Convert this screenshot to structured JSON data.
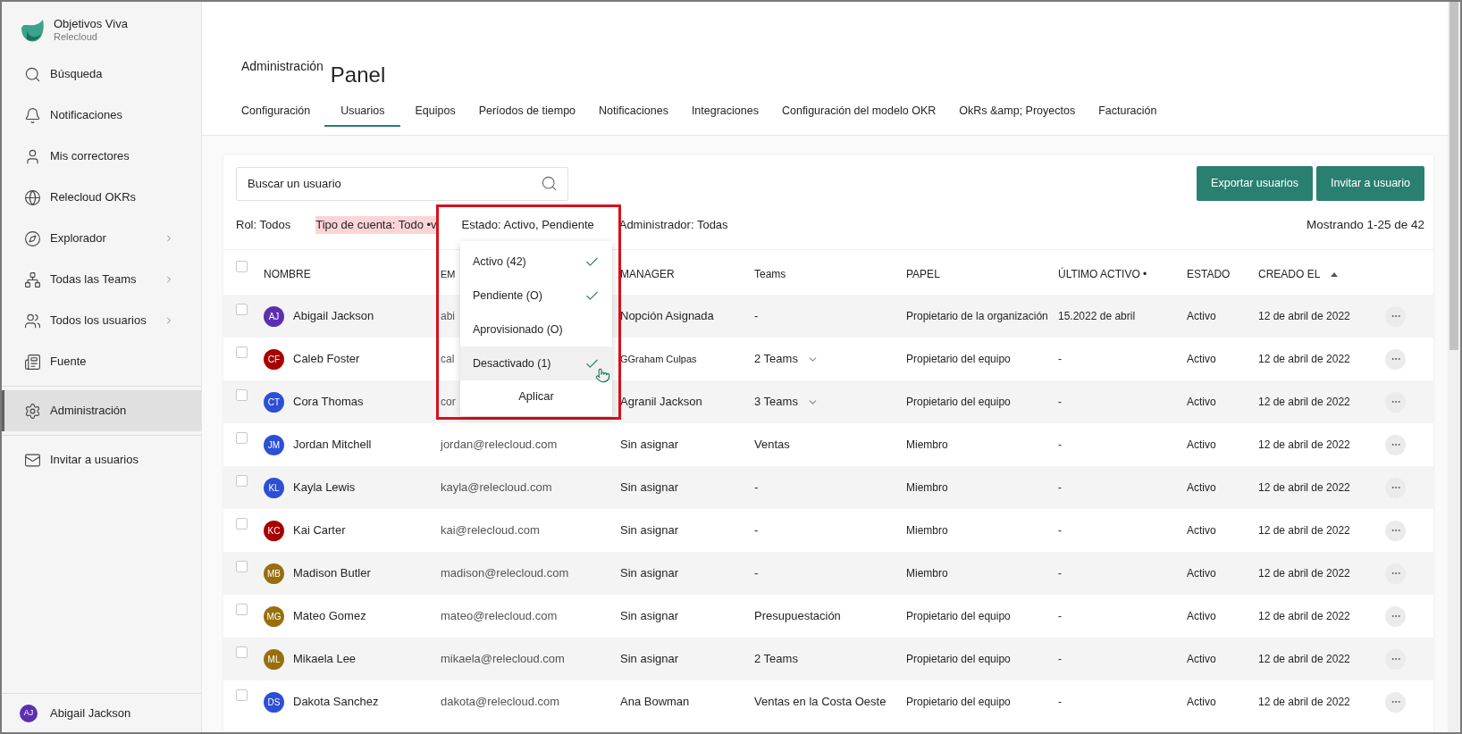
{
  "app": {
    "title": "Objetivos Viva",
    "subtitle": "Relecloud"
  },
  "sidebar": {
    "items": [
      {
        "kind": "search",
        "label": "Búsqueda",
        "selected": false,
        "has_submenu": false
      },
      {
        "kind": "bell",
        "label": "Notificaciones",
        "selected": false,
        "has_submenu": false
      },
      {
        "kind": "person",
        "label": "Mis correctores",
        "selected": false,
        "has_submenu": false
      },
      {
        "kind": "globe",
        "label": "Relecloud OKRs",
        "selected": false,
        "has_submenu": false
      },
      {
        "kind": "compass",
        "label": "Explorador",
        "selected": false,
        "has_submenu": true
      },
      {
        "kind": "teams",
        "label": "Todas las Teams",
        "selected": false,
        "has_submenu": true
      },
      {
        "kind": "people",
        "label": "Todos los usuarios",
        "selected": false,
        "has_submenu": true
      },
      {
        "kind": "feed",
        "label": "Fuente",
        "selected": false,
        "has_submenu": false
      },
      {
        "kind": "gear",
        "label": "Administración",
        "selected": true,
        "has_submenu": false
      },
      {
        "kind": "mail",
        "label": "Invitar a usuarios",
        "selected": false,
        "has_submenu": false
      }
    ],
    "user": {
      "initials": "AJ",
      "name": "Abigail Jackson",
      "color": "#5c2fb0"
    }
  },
  "header": {
    "breadcrumb": "Administración",
    "title": "Panel"
  },
  "tabs": [
    {
      "label": "Configuración",
      "selected": false
    },
    {
      "label": "Usuarios",
      "selected": true
    },
    {
      "label": "Equipos",
      "selected": false
    },
    {
      "label": "Períodos de tiempo",
      "selected": false
    },
    {
      "label": "Notificaciones",
      "selected": false
    },
    {
      "label": "Integraciones",
      "selected": false
    },
    {
      "label": "Configuración del modelo OKR",
      "selected": false
    },
    {
      "label": "OkRs &amp; Proyectos",
      "selected": false
    },
    {
      "label": "Facturación",
      "selected": false
    }
  ],
  "toolbar": {
    "search": {
      "placeholder": "Buscar un usuario"
    },
    "buttons": [
      "Exportar usuarios",
      "Invitar a usuario"
    ]
  },
  "filters": [
    {
      "label": "Rol: Todos",
      "highlighted": false
    },
    {
      "label": "Tipo de cuenta: Todo •v",
      "highlighted": true
    },
    {
      "label": "Estado: Activo, Pendiente",
      "highlighted": false
    },
    {
      "label": "Administrador: Todas",
      "highlighted": false
    }
  ],
  "showing": "Mostrando 1-25 de 42",
  "status_dropdown": {
    "options": [
      {
        "label": "Activo (42)",
        "checked": true,
        "hovered": false
      },
      {
        "label": "Pendiente (O)",
        "checked": true,
        "hovered": false
      },
      {
        "label": "Aprovisionado (O)",
        "checked": false,
        "hovered": false
      },
      {
        "label": "Desactivado (1)",
        "checked": true,
        "hovered": true
      }
    ],
    "apply": "Aplicar"
  },
  "table": {
    "header_checked": false,
    "columns": [
      {
        "label": "NOMBRE",
        "sorted": false
      },
      {
        "label": "EM",
        "sorted": false
      },
      {
        "label": "MANAGER",
        "sorted": false
      },
      {
        "label": "Teams",
        "sorted": false
      },
      {
        "label": "PAPEL",
        "sorted": false
      },
      {
        "label": "ÚLTIMO ACTIVO •",
        "sorted": false
      },
      {
        "label": "ESTADO",
        "sorted": false
      },
      {
        "label": "CREADO EL",
        "sorted": true
      }
    ],
    "rows": [
      {
        "checked": false,
        "initials": "AJ",
        "color": "#5c2fb0",
        "name": "Abigail Jackson",
        "email": "abi",
        "manager": "Nopción Asignada",
        "teams": "-",
        "teams_expandable": false,
        "role": "Propietario de la organización",
        "last_active": "15.2022 de abril",
        "status": "Activo",
        "created": "12 de abril de 2022"
      },
      {
        "checked": false,
        "initials": "CF",
        "color": "#a80000",
        "name": "Caleb Foster",
        "email": "cal",
        "manager": "GGraham Culpas",
        "teams": "2 Teams",
        "teams_expandable": true,
        "role": "Propietario del equipo",
        "last_active": "-",
        "status": "Activo",
        "created": "12 de abril de 2022"
      },
      {
        "checked": false,
        "initials": "CT",
        "color": "#2b4fd6",
        "name": "Cora Thomas",
        "email": "cor",
        "manager": "Agranil Jackson",
        "teams": "3 Teams",
        "teams_expandable": true,
        "role": "Propietario del equipo",
        "last_active": "-",
        "status": "Activo",
        "created": "12 de abril de 2022"
      },
      {
        "checked": false,
        "initials": "JM",
        "color": "#2b4fd6",
        "name": "Jordan Mitchell",
        "email": "jordan@relecloud.com",
        "manager": "Sin asignar",
        "teams": "Ventas",
        "teams_expandable": false,
        "role": "Miembro",
        "last_active": "-",
        "status": "Activo",
        "created": "12 de abril de 2022"
      },
      {
        "checked": false,
        "initials": "KL",
        "color": "#2b4fd6",
        "name": "Kayla Lewis",
        "email": "kayla@relecloud.com",
        "manager": "Sin asignar",
        "teams": "-",
        "teams_expandable": false,
        "role": "Miembro",
        "last_active": "-",
        "status": "Activo",
        "created": "12 de abril de 2022"
      },
      {
        "checked": false,
        "initials": "KC",
        "color": "#a80000",
        "name": "Kai Carter",
        "email": "kai@relecloud.com",
        "manager": "Sin asignar",
        "teams": "-",
        "teams_expandable": false,
        "role": "Miembro",
        "last_active": "-",
        "status": "Activo",
        "created": "12 de abril de 2022"
      },
      {
        "checked": false,
        "initials": "MB",
        "color": "#986f0b",
        "name": "Madison Butler",
        "email": "madison@relecloud.com",
        "manager": "Sin asignar",
        "teams": "-",
        "teams_expandable": false,
        "role": "Miembro",
        "last_active": "-",
        "status": "Activo",
        "created": "12 de abril de 2022"
      },
      {
        "checked": false,
        "initials": "MG",
        "color": "#986f0b",
        "name": "Mateo Gomez",
        "email": "mateo@relecloud.com",
        "manager": "Sin asignar",
        "teams": "Presupuestación",
        "teams_expandable": false,
        "role": "Propietario del equipo",
        "last_active": "-",
        "status": "Activo",
        "created": "12 de abril de 2022"
      },
      {
        "checked": false,
        "initials": "ML",
        "color": "#986f0b",
        "name": "Mikaela Lee",
        "email": "mikaela@relecloud.com",
        "manager": "Sin asignar",
        "teams": "2 Teams",
        "teams_expandable": false,
        "role": "Propietario del equipo",
        "last_active": "-",
        "status": "Activo",
        "created": "12 de abril de 2022"
      },
      {
        "checked": false,
        "initials": "DS",
        "color": "#2b4fd6",
        "name": "Dakota Sanchez",
        "email": "dakota@relecloud.com",
        "manager": "Ana Bowman",
        "teams": "Ventas en la Costa Oeste",
        "teams_expandable": false,
        "role": "Propietario del equipo",
        "last_active": "-",
        "status": "Activo",
        "created": "12 de abril de 2022"
      }
    ]
  }
}
